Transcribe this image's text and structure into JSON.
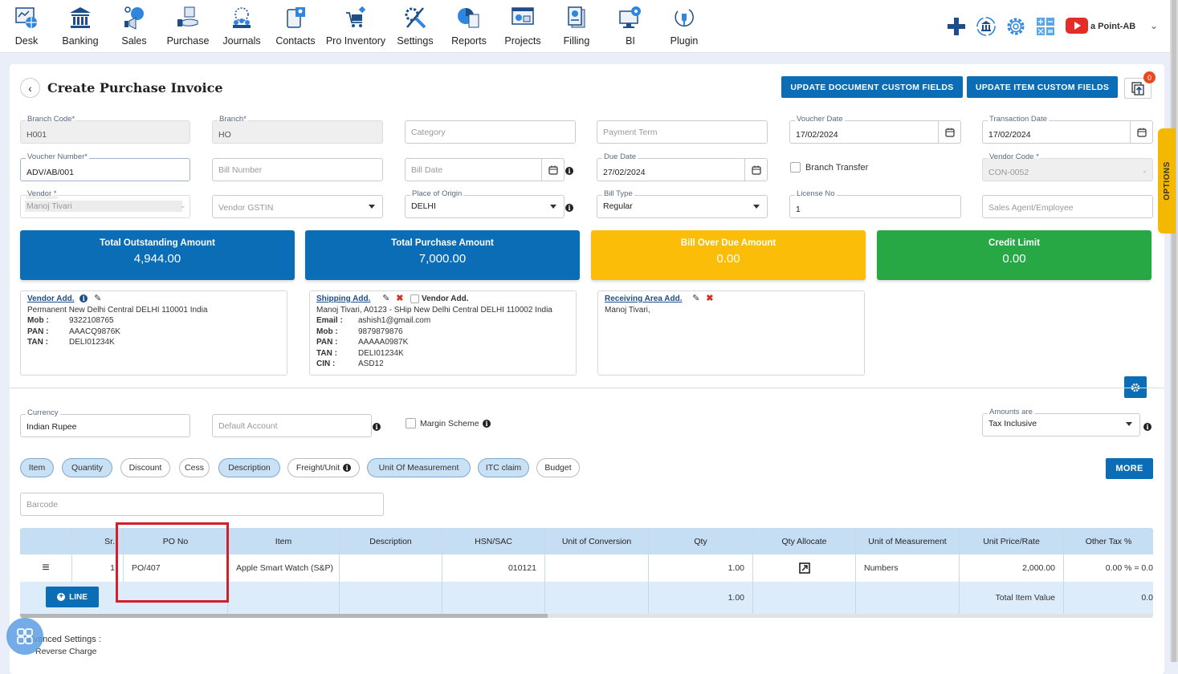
{
  "nav": {
    "items": [
      {
        "label": "Desk",
        "icon": "desk-icon"
      },
      {
        "label": "Banking",
        "icon": "bank-icon"
      },
      {
        "label": "Sales",
        "icon": "sales-icon"
      },
      {
        "label": "Purchase",
        "icon": "purchase-icon"
      },
      {
        "label": "Journals",
        "icon": "journals-icon"
      },
      {
        "label": "Contacts",
        "icon": "contacts-icon"
      },
      {
        "label": "Pro Inventory",
        "icon": "inventory-icon"
      },
      {
        "label": "Settings",
        "icon": "settings-icon"
      },
      {
        "label": "Reports",
        "icon": "reports-icon"
      },
      {
        "label": "Projects",
        "icon": "projects-icon"
      },
      {
        "label": "Filling",
        "icon": "filling-icon"
      },
      {
        "label": "BI",
        "icon": "bi-icon"
      },
      {
        "label": "Plugin",
        "icon": "plugin-icon"
      }
    ],
    "company": "a Point-AB"
  },
  "header": {
    "title": "Create Purchase Invoice",
    "update_doc_fields": "UPDATE DOCUMENT CUSTOM FIELDS",
    "update_item_fields": "UPDATE ITEM CUSTOM FIELDS",
    "notification_count": "0"
  },
  "form": {
    "branch_code": {
      "label": "Branch Code*",
      "value": "H001"
    },
    "branch": {
      "label": "Branch*",
      "value": "HO"
    },
    "category": {
      "placeholder": "Category"
    },
    "payment_term": {
      "placeholder": "Payment Term"
    },
    "voucher_date": {
      "label": "Voucher Date",
      "value": "17/02/2024"
    },
    "transaction_date": {
      "label": "Transaction Date",
      "value": "17/02/2024"
    },
    "voucher_number": {
      "label": "Voucher Number*",
      "value": "ADV/AB/001"
    },
    "bill_number": {
      "placeholder": "Bill Number"
    },
    "bill_date": {
      "placeholder": "Bill Date"
    },
    "due_date": {
      "label": "Due Date",
      "value": "27/02/2024"
    },
    "branch_transfer": {
      "label": "Branch Transfer",
      "checked": false
    },
    "vendor_code": {
      "label": "Vendor Code *",
      "value": "CON-0052"
    },
    "vendor": {
      "label": "Vendor *",
      "value": "Manoj Tivari"
    },
    "vendor_gstin": {
      "placeholder": "Vendor GSTIN"
    },
    "place_of_origin": {
      "label": "Place of Origin",
      "value": "DELHI"
    },
    "bill_type": {
      "label": "Bill Type",
      "value": "Regular"
    },
    "license_no": {
      "label": "License No",
      "value": "1"
    },
    "sales_agent": {
      "placeholder": "Sales Agent/Employee"
    },
    "currency": {
      "label": "Currency",
      "value": "Indian Rupee"
    },
    "default_account": {
      "placeholder": "Default Account"
    },
    "margin_scheme": {
      "label": "Margin Scheme",
      "checked": false
    },
    "amounts_are": {
      "label": "Amounts are",
      "value": "Tax Inclusive"
    },
    "barcode": {
      "placeholder": "Barcode"
    }
  },
  "stats": [
    {
      "title": "Total Outstanding Amount",
      "value": "4,944.00",
      "color": "#0a6db5"
    },
    {
      "title": "Total Purchase Amount",
      "value": "7,000.00",
      "color": "#0a6db5"
    },
    {
      "title": "Bill Over Due Amount",
      "value": "0.00",
      "color": "#fbbd08"
    },
    {
      "title": "Credit Limit",
      "value": "0.00",
      "color": "#28a745"
    }
  ],
  "vendor_address": {
    "heading": "Vendor Add.",
    "line": "Permanent New Delhi Central DELHI 110001 India",
    "rows": [
      {
        "k": "Mob :",
        "v": "9322108765"
      },
      {
        "k": "PAN :",
        "v": "AAACQ9876K"
      },
      {
        "k": "TAN :",
        "v": "DELI01234K"
      }
    ]
  },
  "shipping_address": {
    "heading": "Shipping Add.",
    "copy_label": "Vendor Add.",
    "line": "Manoj Tivari, A0123 - SHip New Delhi Central DELHI 110002 India",
    "rows": [
      {
        "k": "Email :",
        "v": "ashish1@gmail.com"
      },
      {
        "k": "Mob :",
        "v": "9879879876"
      },
      {
        "k": "PAN :",
        "v": "AAAAA0987K"
      },
      {
        "k": "TAN :",
        "v": "DELI01234K"
      },
      {
        "k": "CIN :",
        "v": "ASD12"
      }
    ]
  },
  "receiving_address": {
    "heading": "Receiving Area Add.",
    "line": "Manoj Tivari,"
  },
  "column_pills": [
    {
      "label": "Item",
      "on": true
    },
    {
      "label": "Quantity",
      "on": true
    },
    {
      "label": "Discount",
      "on": false
    },
    {
      "label": "Cess",
      "on": false
    },
    {
      "label": "Description",
      "on": true
    },
    {
      "label": "Freight/Unit",
      "on": false
    },
    {
      "label": "Unit Of Measurement",
      "on": true
    },
    {
      "label": "ITC claim",
      "on": true
    },
    {
      "label": "Budget",
      "on": false
    }
  ],
  "more_label": "MORE",
  "table": {
    "headers": [
      "",
      "Sr.",
      "PO No",
      "Item",
      "Description",
      "HSN/SAC",
      "Unit of Conversion",
      "Qty",
      "Qty Allocate",
      "Unit of Measurement",
      "Unit Price/Rate",
      "Other Tax %"
    ],
    "rows": [
      {
        "sr": "1",
        "po_no": "PO/407",
        "item": "Apple Smart Watch (S&P)",
        "description": "",
        "hsn": "010121",
        "unit_conversion": "",
        "qty": "1.00",
        "uom": "Numbers",
        "unit_price": "2,000.00",
        "other_tax": "0.00 % = 0.0"
      }
    ],
    "footer": {
      "qty_total": "1.00",
      "total_item_value_label": "Total Item Value",
      "total_item_value": "0.0"
    },
    "add_line_label": "LINE"
  },
  "options_tab": "OPTIONS",
  "advanced": {
    "title": "Advanced Settings :",
    "reverse_charge": "Reverse Charge"
  }
}
